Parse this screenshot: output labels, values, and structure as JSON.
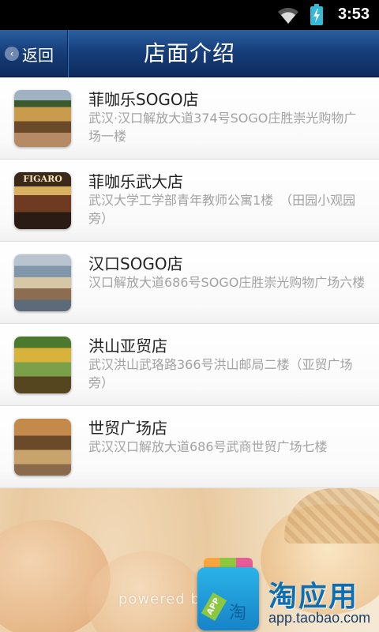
{
  "status_bar": {
    "time": "3:53",
    "icons": [
      "wifi-icon",
      "battery-charging-icon"
    ]
  },
  "header": {
    "back_label": "返回",
    "title": "店面介绍",
    "colors": {
      "bar_top": "#2a5fa0",
      "bar_bottom": "#0d2b5e"
    }
  },
  "stores": [
    {
      "name": "菲咖乐SOGO店",
      "address": "武汉·汉口解放大道374号SOGO庄胜崇光购物广场一楼"
    },
    {
      "name": "菲咖乐武大店",
      "address": "武汉大学工学部青年教师公寓1楼　（田园小观园旁）",
      "thumb_text": "FIGARO"
    },
    {
      "name": "汉口SOGO店",
      "address": "汉口解放大道686号SOGO庄胜崇光购物广场六楼"
    },
    {
      "name": "洪山亚贸店",
      "address": "武汉洪山武珞路366号洪山邮局二楼（亚贸广场旁）"
    },
    {
      "name": "世贸广场店",
      "address": "武汉汉口解放大道686号武商世贸广场七楼"
    }
  ],
  "footer": {
    "powered_text": "powered b",
    "app_tag": "APP",
    "app_glyph": "淘",
    "brand_name": "淘应用",
    "brand_url": "app.taobao.com"
  }
}
